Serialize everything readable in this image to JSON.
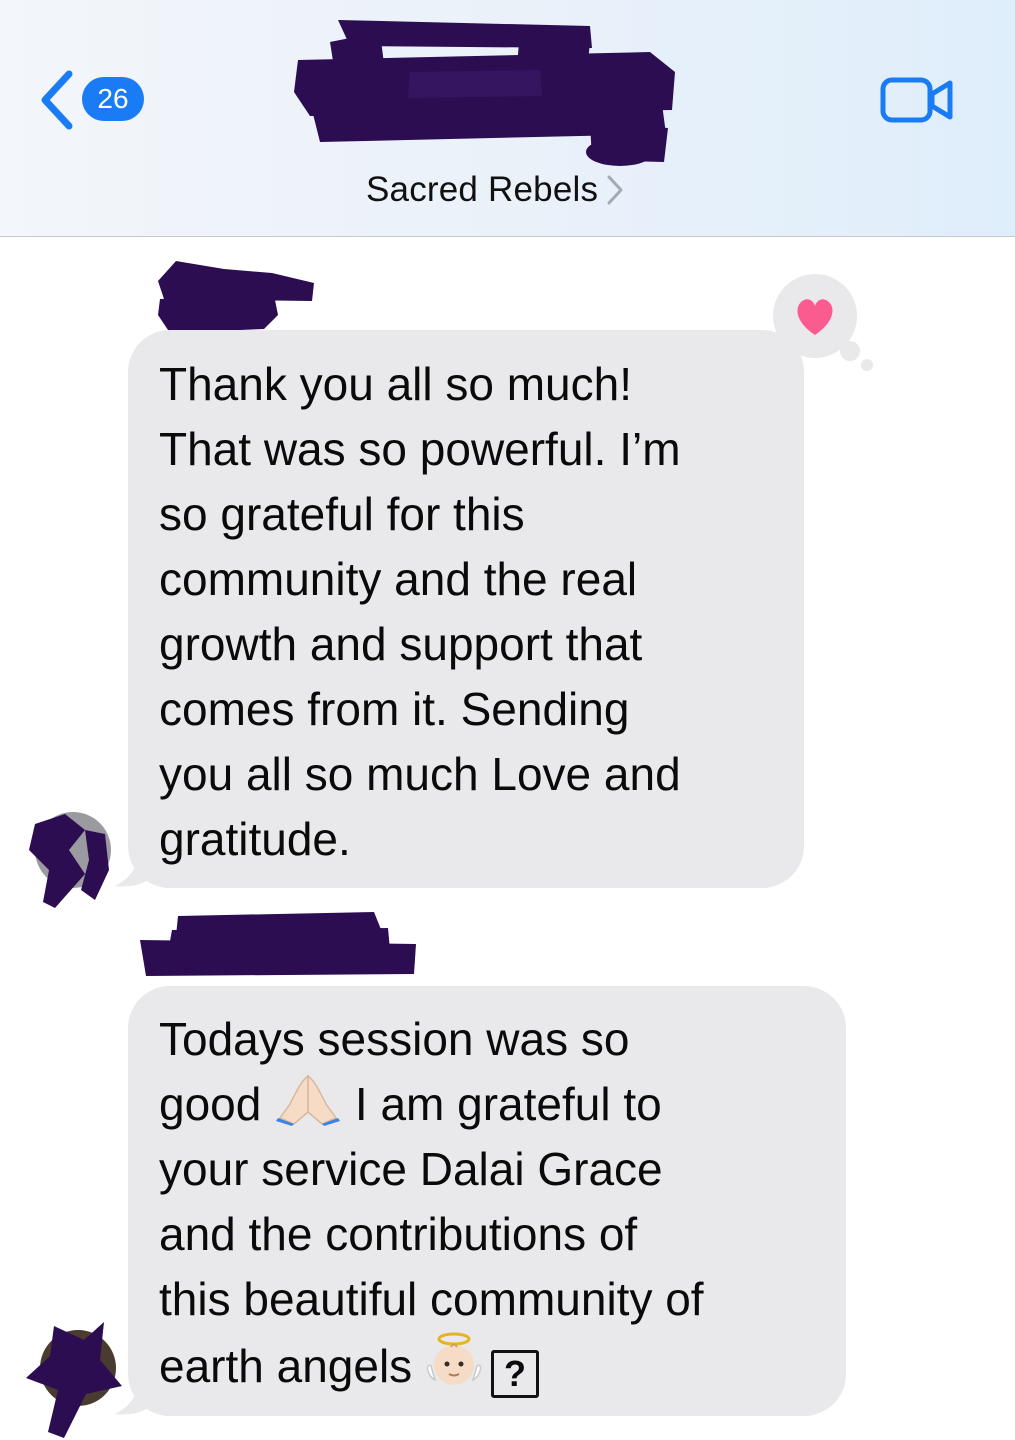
{
  "header": {
    "unread_count": "26",
    "group_name": "Sacred Rebels",
    "accent_color": "#1a7cf5"
  },
  "messages": [
    {
      "text": "Thank you all so much!\nThat was so powerful. I’m\nso grateful for this\ncommunity and the real\ngrowth and support that\ncomes from it.  Sending\nyou all so much Love and\ngratitude.",
      "reaction": "heart"
    },
    {
      "text_before_emoji_1": "Todays session was so\ngood ",
      "emoji_1": "folded-hands",
      "text_after_emoji_1": " I am grateful to\nyour service Dalai Grace\nand the contributions of\nthis beautiful community of\nearth angels ",
      "emoji_2": "baby-angel",
      "missing_glyph": "?"
    }
  ],
  "colors": {
    "bubble_gray": "#e9e9eb",
    "heart_pink": "#fb5c8f",
    "redaction_purple": "#2c0d52"
  }
}
